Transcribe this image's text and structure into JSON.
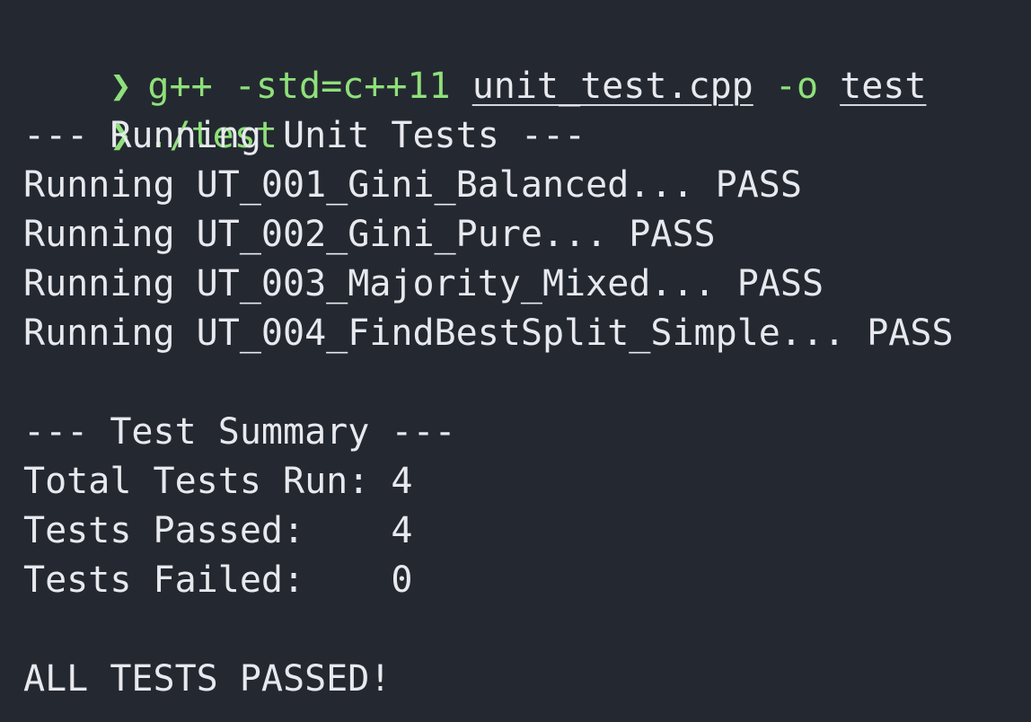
{
  "prompt_symbol": "❯",
  "command1": {
    "program": "g++",
    "flag": "-std=c++11",
    "source": "unit_test.cpp",
    "out_flag": "-o",
    "output": "test"
  },
  "command2": "./test",
  "running_header": "--- Running Unit Tests ---",
  "test_lines": [
    "Running UT_001_Gini_Balanced... PASS",
    "Running UT_002_Gini_Pure... PASS",
    "Running UT_003_Majority_Mixed... PASS",
    "Running UT_004_FindBestSplit_Simple... PASS"
  ],
  "summary_header": "--- Test Summary ---",
  "summary": {
    "total": "Total Tests Run: 4",
    "passed": "Tests Passed:    4",
    "failed": "Tests Failed:    0"
  },
  "final_message": "ALL TESTS PASSED!",
  "colors": {
    "background": "#242931",
    "prompt": "#8fe07a",
    "text": "#e7e9ee"
  }
}
